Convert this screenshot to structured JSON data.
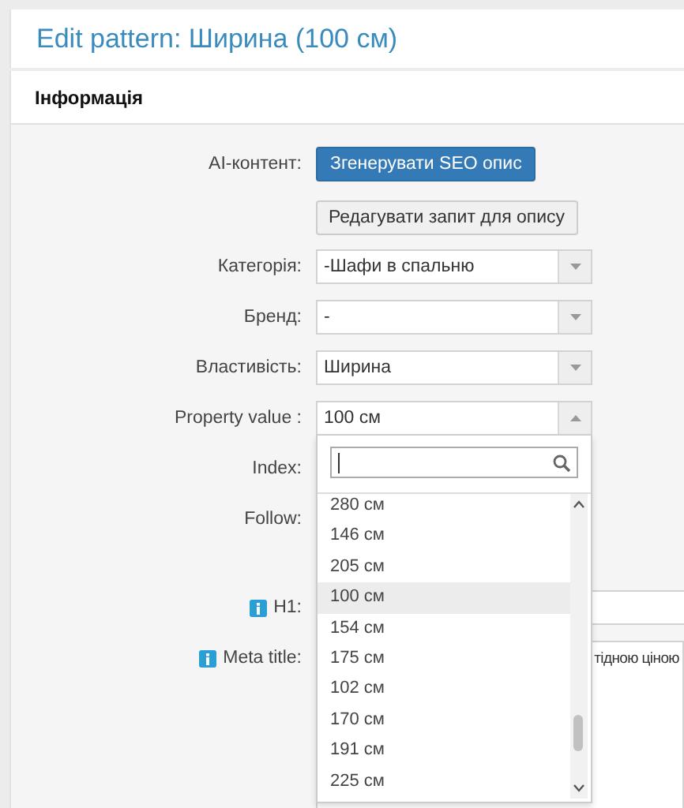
{
  "title": "Edit pattern: Ширина (100 см)",
  "section": "Інформація",
  "ai": {
    "label": "AI-контент:",
    "button": "Згенерувати SEO опис"
  },
  "edit_prompt_button": "Редагувати запит для опису",
  "selects": [
    {
      "label": "Категорія:",
      "value": "-Шафи в спальню",
      "open": false
    },
    {
      "label": "Бренд:",
      "value": "-",
      "open": false
    },
    {
      "label": "Властивість:",
      "value": "Ширина",
      "open": false
    },
    {
      "label": "Property value :",
      "value": "100 см",
      "open": true
    }
  ],
  "dropdown": {
    "options": [
      {
        "label": "280 см",
        "selected": false
      },
      {
        "label": "146 см",
        "selected": false
      },
      {
        "label": "205 см",
        "selected": false
      },
      {
        "label": "100 см",
        "selected": true
      },
      {
        "label": "154 см",
        "selected": false
      },
      {
        "label": "175 см",
        "selected": false
      },
      {
        "label": "102 см",
        "selected": false
      },
      {
        "label": "170 см",
        "selected": false
      },
      {
        "label": "191 см",
        "selected": false
      },
      {
        "label": "225 см",
        "selected": false
      }
    ]
  },
  "fields": [
    {
      "label": "Index:",
      "kind": "covered",
      "info": false
    },
    {
      "label": "Follow:",
      "kind": "covered",
      "info": false
    },
    {
      "label": "H1:",
      "kind": "input",
      "info": true
    },
    {
      "label": "Meta title:",
      "kind": "textarea",
      "info": true,
      "value": "тідною ціною"
    }
  ]
}
